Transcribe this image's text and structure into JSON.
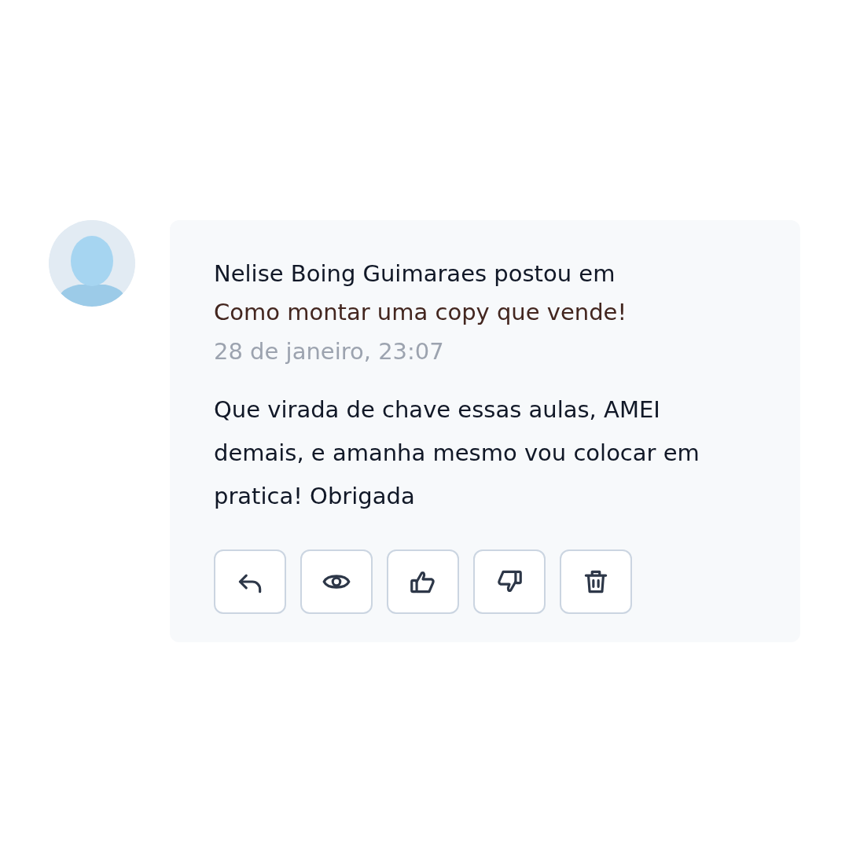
{
  "comment": {
    "author_line": "Nelise Boing Guimaraes postou em",
    "topic": "Como montar uma copy que vende!",
    "date": "28 de janeiro, 23:07",
    "body": "Que virada de chave essas aulas, AMEI demais, e amanha mesmo vou colocar em pratica! Obrigada",
    "actions": [
      {
        "kind": "reply"
      },
      {
        "kind": "view"
      },
      {
        "kind": "like"
      },
      {
        "kind": "dislike"
      },
      {
        "kind": "delete"
      }
    ]
  }
}
